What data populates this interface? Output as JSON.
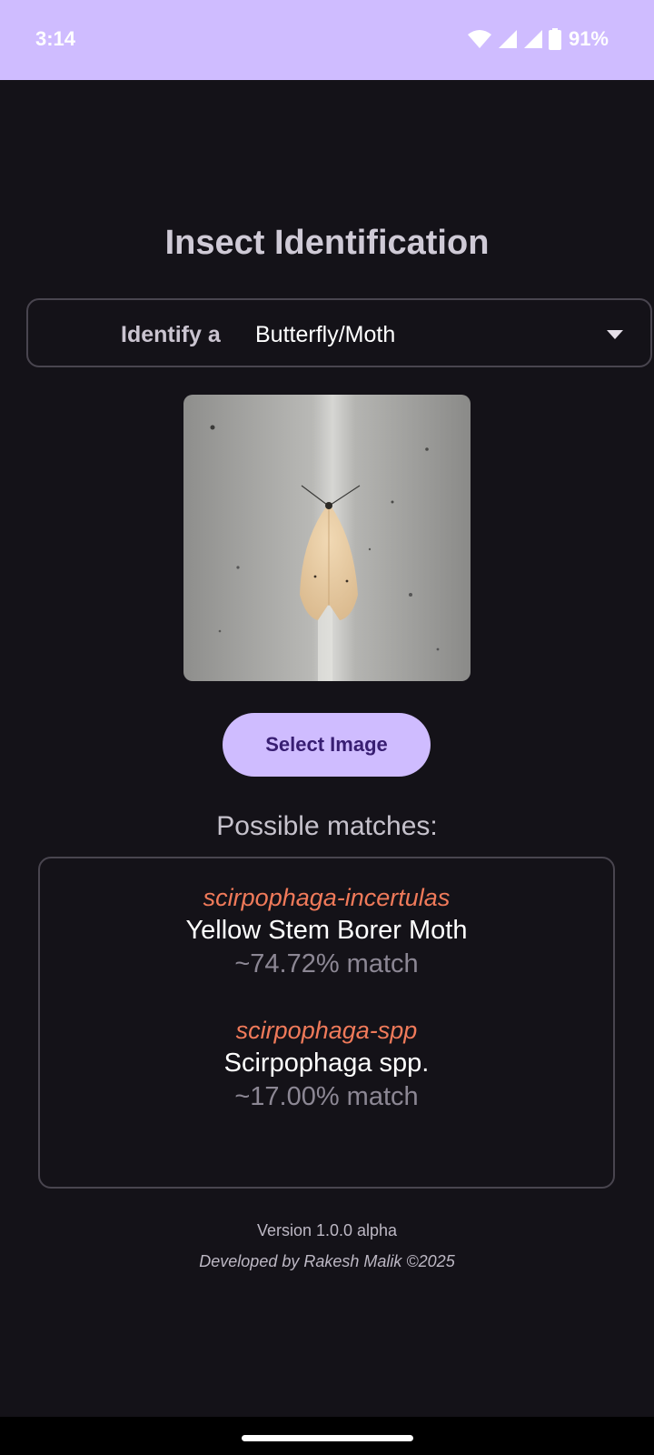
{
  "status_bar": {
    "time": "3:14",
    "battery": "91%",
    "icons": [
      "wifi-icon",
      "signal-icon",
      "signal-icon",
      "battery-icon"
    ]
  },
  "page": {
    "title": "Insect Identification"
  },
  "selector": {
    "label": "Identify a",
    "value": "Butterfly/Moth",
    "icon": "dropdown-arrow-icon"
  },
  "actions": {
    "select_image": "Select Image"
  },
  "matches": {
    "heading": "Possible matches:",
    "items": [
      {
        "slug": "scirpophaga-incertulas",
        "name": "Yellow Stem Borer Moth",
        "confidence": "~74.72% match"
      },
      {
        "slug": "scirpophaga-spp",
        "name": "Scirpophaga spp.",
        "confidence": "~17.00% match"
      }
    ]
  },
  "footer": {
    "version": "Version 1.0.0 alpha",
    "credit": "Developed by Rakesh Malik ©2025"
  },
  "colors": {
    "accent": "#cfbcff",
    "background": "#141218",
    "slug": "#f07a5a"
  }
}
